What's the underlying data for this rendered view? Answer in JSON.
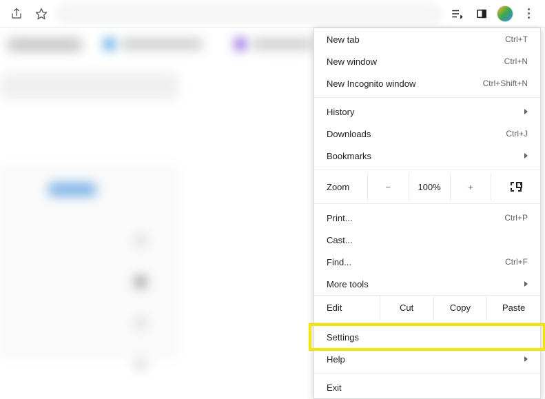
{
  "menu": {
    "newTab": {
      "label": "New tab",
      "shortcut": "Ctrl+T"
    },
    "newWindow": {
      "label": "New window",
      "shortcut": "Ctrl+N"
    },
    "newIncognito": {
      "label": "New Incognito window",
      "shortcut": "Ctrl+Shift+N"
    },
    "history": {
      "label": "History"
    },
    "downloads": {
      "label": "Downloads",
      "shortcut": "Ctrl+J"
    },
    "bookmarks": {
      "label": "Bookmarks"
    },
    "zoom": {
      "label": "Zoom",
      "minus": "−",
      "value": "100%",
      "plus": "+"
    },
    "print": {
      "label": "Print...",
      "shortcut": "Ctrl+P"
    },
    "cast": {
      "label": "Cast..."
    },
    "find": {
      "label": "Find...",
      "shortcut": "Ctrl+F"
    },
    "moreTools": {
      "label": "More tools"
    },
    "edit": {
      "label": "Edit",
      "cut": "Cut",
      "copy": "Copy",
      "paste": "Paste"
    },
    "settings": {
      "label": "Settings"
    },
    "help": {
      "label": "Help"
    },
    "exit": {
      "label": "Exit"
    }
  }
}
